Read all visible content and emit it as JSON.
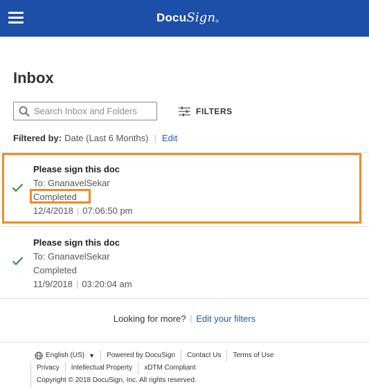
{
  "header": {
    "logo_main": "Docu",
    "logo_script": "Sign",
    "logo_tm": "®"
  },
  "page": {
    "title": "Inbox"
  },
  "search": {
    "placeholder": "Search Inbox and Folders"
  },
  "filters": {
    "label": "FILTERS",
    "filtered_by_label": "Filtered by:",
    "filtered_by_value": "Date (Last 6 Months)",
    "edit_label": "Edit"
  },
  "envelopes": [
    {
      "subject": "Please sign this doc",
      "to": "To: GnanavelSekar",
      "status": "Completed",
      "date": "12/4/2018",
      "time": "07:06:50 pm"
    },
    {
      "subject": "Please sign this doc",
      "to": "To: GnanavelSekar",
      "status": "Completed",
      "date": "11/9/2018",
      "time": "03:20:04 am"
    }
  ],
  "more": {
    "text": "Looking for more?",
    "link": "Edit your filters"
  },
  "footer": {
    "language": "English (US)",
    "links_row1": [
      "Powered by DocuSign",
      "Contact Us",
      "Terms of Use"
    ],
    "links_row2": [
      "Privacy",
      "Intellectual Property",
      "xDTM Compliant"
    ],
    "copyright": "Copyright © 2018 DocuSign, Inc. All rights reserved."
  },
  "colors": {
    "header_bg": "#1e4fa8",
    "link": "#1e5bb8",
    "check": "#2f8a3c",
    "highlight": "#f08a24"
  },
  "icons": {
    "menu": "hamburger-icon",
    "search": "search-icon",
    "filters": "sliders-icon",
    "status": "check-icon",
    "language": "globe-icon"
  }
}
